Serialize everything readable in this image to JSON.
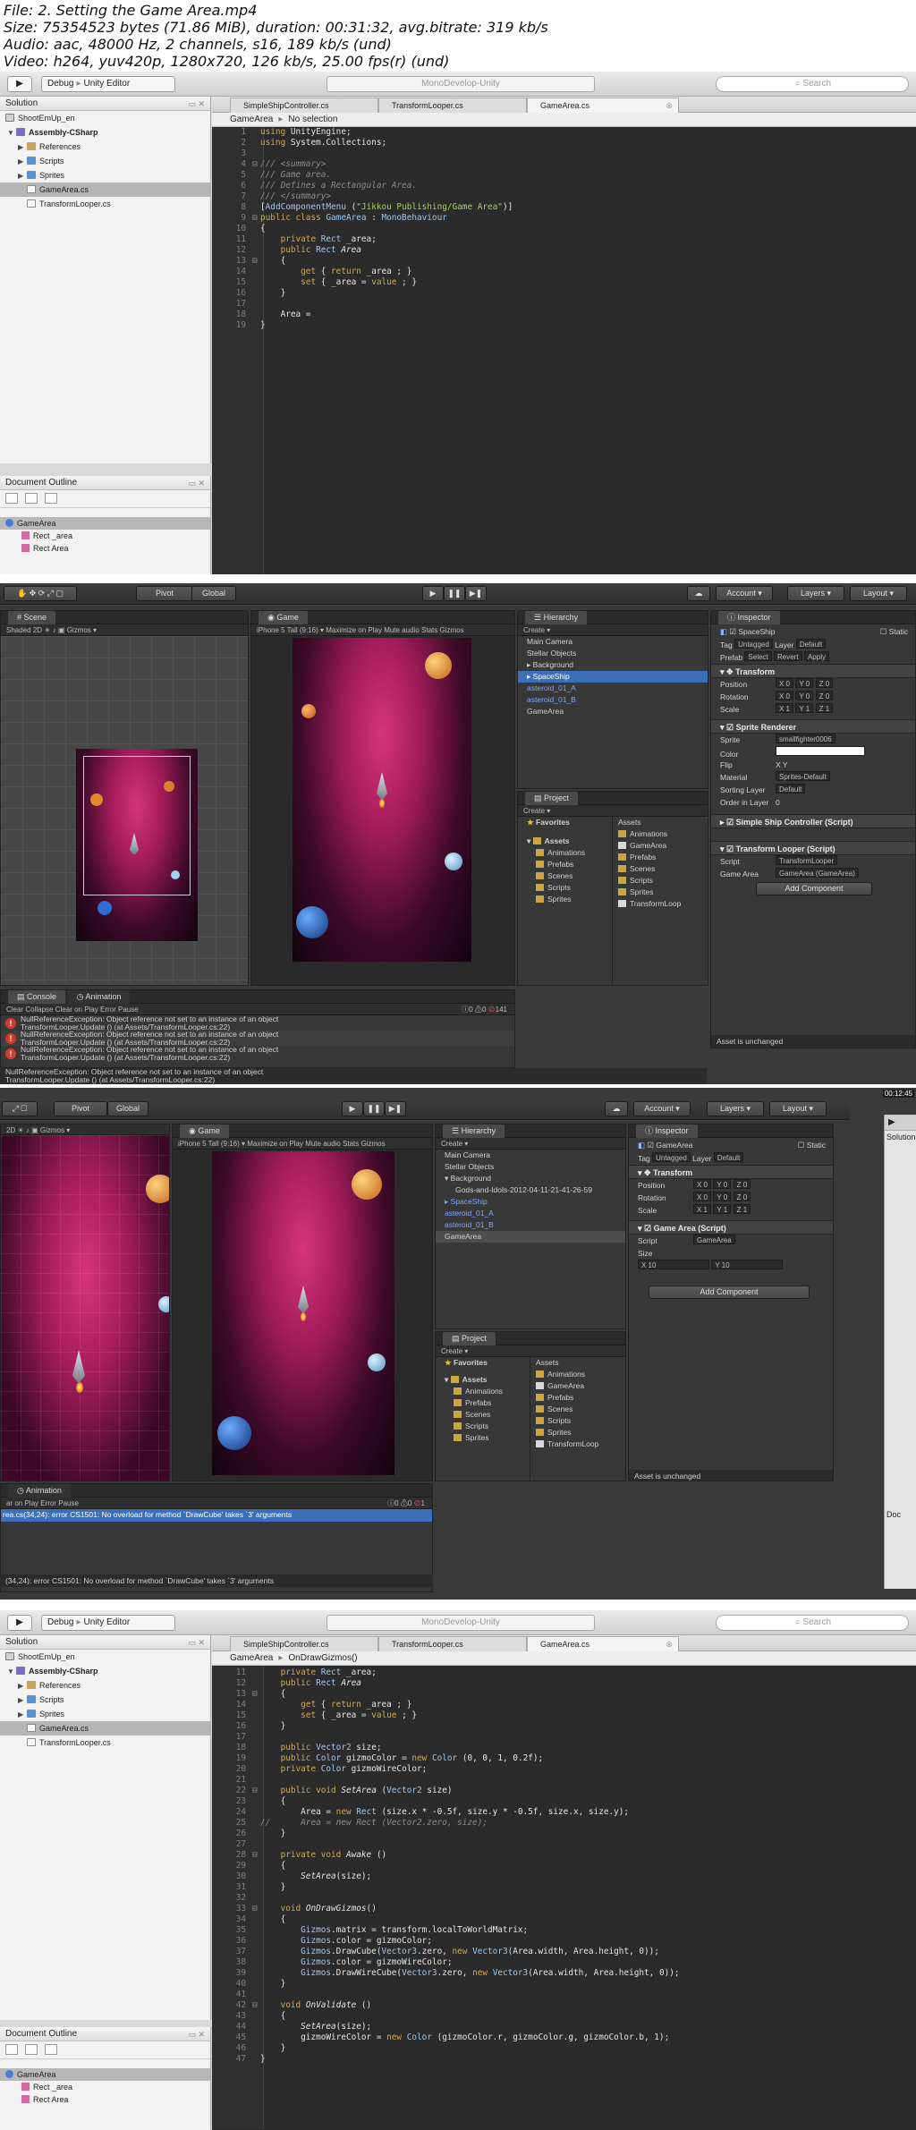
{
  "header": {
    "file": "File: 2. Setting the Game Area.mp4",
    "size": "Size: 75354523 bytes (71.86 MiB), duration: 00:31:32, avg.bitrate: 319 kb/s",
    "audio": "Audio: aac, 48000 Hz, 2 channels, s16, 189 kb/s (und)",
    "video": "Video: h264, yuv420p, 1280x720, 126 kb/s, 25.00 fps(r) (und)"
  },
  "md": {
    "config": "Debug",
    "target": "Unity Editor",
    "status": "MonoDevelop-Unity",
    "search_placeholder": "Search",
    "solution_title": "Solution",
    "tree": [
      "ShootEmUp_en",
      "Assembly-CSharp",
      "References",
      "Scripts",
      "Sprites",
      "GameArea.cs",
      "TransformLooper.cs"
    ],
    "tabs": [
      "SimpleShipController.cs",
      "TransformLooper.cs",
      "GameArea.cs"
    ],
    "outline_title": "Document Outline",
    "outline_class": "GameArea",
    "outline_members": [
      "Rect _area",
      "Rect Area"
    ],
    "breadcrumb1": [
      "GameArea",
      "No selection"
    ],
    "breadcrumb4": [
      "GameArea",
      "OnDrawGizmos()"
    ]
  },
  "code1": [
    {
      "n": "1",
      "html": "<span class=\"kw\">using</span> UnityEngine;"
    },
    {
      "n": "2",
      "html": "<span class=\"kw\">using</span> System.Collections;"
    },
    {
      "n": "3",
      "html": ""
    },
    {
      "n": "4",
      "html": "<span class=\"cm\">/// &lt;summary&gt;</span>",
      "fold": "⊟"
    },
    {
      "n": "5",
      "html": "<span class=\"cm\">/// Game area.</span>"
    },
    {
      "n": "6",
      "html": "<span class=\"cm\">/// Defines a Rectangular Area.</span>"
    },
    {
      "n": "7",
      "html": "<span class=\"cm\">/// &lt;/summary&gt;</span>"
    },
    {
      "n": "8",
      "html": "[<span class=\"ty\">AddComponentMenu</span> (<span class=\"str\">\"Jikkou Publishing/Game Area\"</span>)]"
    },
    {
      "n": "9",
      "html": "<span class=\"kw\">public class</span> <span class=\"ty\">GameArea</span> : <span class=\"ty\">MonoBehaviour</span>",
      "fold": "⊟"
    },
    {
      "n": "10",
      "html": "{"
    },
    {
      "n": "11",
      "html": "    <span class=\"kw\">private</span> <span class=\"ty\">Rect</span> _area;"
    },
    {
      "n": "12",
      "html": "    <span class=\"kw\">public</span> <span class=\"ty\">Rect</span> <span class=\"it\">Area</span>"
    },
    {
      "n": "13",
      "html": "    {",
      "fold": "⊟"
    },
    {
      "n": "14",
      "html": "        <span class=\"kw\">get</span> { <span class=\"kw\">return</span> _area ; }"
    },
    {
      "n": "15",
      "html": "        <span class=\"kw\">set</span> { _area = <span class=\"kw\">value</span> ; }"
    },
    {
      "n": "16",
      "html": "    }"
    },
    {
      "n": "17",
      "html": ""
    },
    {
      "n": "18",
      "html": "    Area ="
    },
    {
      "n": "19",
      "html": "}"
    }
  ],
  "code4": [
    {
      "n": "11",
      "html": "    <span class=\"kw\">private</span> <span class=\"ty\">Rect</span> _area;"
    },
    {
      "n": "12",
      "html": "    <span class=\"kw\">public</span> <span class=\"ty\">Rect</span> <span class=\"it\">Area</span>"
    },
    {
      "n": "13",
      "html": "    {",
      "fold": "⊟"
    },
    {
      "n": "14",
      "html": "        <span class=\"kw\">get</span> { <span class=\"kw\">return</span> _area ; }"
    },
    {
      "n": "15",
      "html": "        <span class=\"kw\">set</span> { _area = <span class=\"kw\">value</span> ; }"
    },
    {
      "n": "16",
      "html": "    }"
    },
    {
      "n": "17",
      "html": ""
    },
    {
      "n": "18",
      "html": "    <span class=\"kw\">public</span> <span class=\"ty\">Vector2</span> size;"
    },
    {
      "n": "19",
      "html": "    <span class=\"kw\">public</span> <span class=\"ty\">Color</span> gizmoColor = <span class=\"kw\">new</span> <span class=\"ty\">Color</span> (0, 0, 1, 0.2f);"
    },
    {
      "n": "20",
      "html": "    <span class=\"kw\">private</span> <span class=\"ty\">Color</span> gizmoWireColor;"
    },
    {
      "n": "21",
      "html": ""
    },
    {
      "n": "22",
      "html": "    <span class=\"kw\">public void</span> <span class=\"it\">SetArea</span> (<span class=\"ty\">Vector2</span> size)",
      "fold": "⊟"
    },
    {
      "n": "23",
      "html": "    {"
    },
    {
      "n": "24",
      "html": "        Area = <span class=\"kw\">new</span> <span class=\"ty\">Rect</span> (size.x * -0.5f, size.y * -0.5f, size.x, size.y);"
    },
    {
      "n": "25",
      "html": "<span class=\"cm\">//      Area = new Rect (Vector2.zero, size);</span>"
    },
    {
      "n": "26",
      "html": "    }"
    },
    {
      "n": "27",
      "html": ""
    },
    {
      "n": "28",
      "html": "    <span class=\"kw\">private void</span> <span class=\"it\">Awake</span> ()",
      "fold": "⊟"
    },
    {
      "n": "29",
      "html": "    {"
    },
    {
      "n": "30",
      "html": "        <span class=\"it\">SetArea</span>(size);"
    },
    {
      "n": "31",
      "html": "    }"
    },
    {
      "n": "32",
      "html": ""
    },
    {
      "n": "33",
      "html": "    <span class=\"kw\">void</span> <span class=\"it\">OnDrawGizmos</span>()",
      "fold": "⊟"
    },
    {
      "n": "34",
      "html": "    {"
    },
    {
      "n": "35",
      "html": "        <span class=\"ty\">Gizmos</span>.matrix = transform.localToWorldMatrix;"
    },
    {
      "n": "36",
      "html": "        <span class=\"ty\">Gizmos</span>.color = gizmoColor;"
    },
    {
      "n": "37",
      "html": "        <span class=\"ty\">Gizmos</span>.DrawCube(<span class=\"ty\">Vector3</span>.zero, <span class=\"kw\">new</span> <span class=\"ty\">Vector3</span>(Area.width, Area.height, 0));"
    },
    {
      "n": "38",
      "html": "        <span class=\"ty\">Gizmos</span>.color = gizmoWireColor;"
    },
    {
      "n": "39",
      "html": "        <span class=\"ty\">Gizmos</span>.DrawWireCube(<span class=\"ty\">Vector3</span>.zero, <span class=\"kw\">new</span> <span class=\"ty\">Vector3</span>(Area.width, Area.height, 0));"
    },
    {
      "n": "40",
      "html": "    }"
    },
    {
      "n": "41",
      "html": ""
    },
    {
      "n": "42",
      "html": "    <span class=\"kw\">void</span> <span class=\"it\">OnValidate</span> ()",
      "fold": "⊟"
    },
    {
      "n": "43",
      "html": "    {"
    },
    {
      "n": "44",
      "html": "        <span class=\"it\">SetArea</span>(size);"
    },
    {
      "n": "45",
      "html": "        gizmoWireColor = <span class=\"kw\">new</span> <span class=\"ty\">Color</span> (gizmoColor.r, gizmoColor.g, gizmoColor.b, 1);"
    },
    {
      "n": "46",
      "html": "    }"
    },
    {
      "n": "47",
      "html": "}"
    }
  ],
  "unity2": {
    "toolbar": {
      "pivot": "Pivot",
      "global": "Global",
      "account": "Account",
      "layers": "Layers",
      "layout": "Layout"
    },
    "scene_tab": "Scene",
    "scene_shading": "Shaded",
    "scene_2d": "2D",
    "gizmos": "Gizmos",
    "game_tab": "Game",
    "game_aspect": "iPhone 5 Tall (9:16)",
    "game_opts": [
      "Maximize on Play",
      "Mute audio",
      "Stats",
      "Gizmos"
    ],
    "hierarchy_tab": "Hierarchy",
    "create": "Create",
    "hierarchy": [
      "Main Camera",
      "Stellar Objects",
      "Background",
      "SpaceShip",
      "asteroid_01_A",
      "asteroid_01_B",
      "GameArea"
    ],
    "project_tab": "Project",
    "favorites": "Favorites",
    "assets_label": "Assets",
    "assets_tree": [
      "Animations",
      "Prefabs",
      "Scenes",
      "Scripts",
      "Sprites"
    ],
    "assets_grid": [
      "Animations",
      "GameArea",
      "Prefabs",
      "Scenes",
      "Scripts",
      "Sprites",
      "TransformLoop"
    ],
    "inspector_tab": "Inspector",
    "obj_name": "SpaceShip",
    "static_label": "Static",
    "tag_label": "Tag",
    "tag_value": "Untagged",
    "layer_label": "Layer",
    "layer_value": "Default",
    "prefab_label": "Prefab",
    "prefab_btns": [
      "Select",
      "Revert",
      "Apply"
    ],
    "transform": "Transform",
    "pos_label": "Position",
    "rot_label": "Rotation",
    "scale_label": "Scale",
    "pos": [
      "X 0",
      "Y 0",
      "Z 0"
    ],
    "rot": [
      "X 0",
      "Y 0",
      "Z 0"
    ],
    "scale": [
      "X 1",
      "Y 1",
      "Z 1"
    ],
    "sprite_renderer": "Sprite Renderer",
    "sr_rows": [
      [
        "Sprite",
        "smallfighter0006"
      ],
      [
        "Color",
        ""
      ],
      [
        "Flip",
        "X   Y"
      ],
      [
        "Material",
        "Sprites-Default"
      ],
      [
        "Sorting Layer",
        "Default"
      ],
      [
        "Order in Layer",
        "0"
      ]
    ],
    "ssc": "Simple Ship Controller (Script)",
    "tl": "Transform Looper (Script)",
    "tl_script_label": "Script",
    "tl_script": "TransformLooper",
    "tl_area_label": "Game Area",
    "tl_area": "GameArea (GameArea)",
    "add_component": "Add Component",
    "console_tab": "Console",
    "animation_tab": "Animation",
    "console_btns": [
      "Clear",
      "Collapse",
      "Clear on Play",
      "Error Pause"
    ],
    "console_count": "141",
    "console_counts": [
      "0",
      "0"
    ],
    "errors": [
      [
        "NullReferenceException: Object reference not set to an instance of an object",
        "TransformLooper.Update () (at Assets/TransformLooper.cs:22)"
      ],
      [
        "NullReferenceException: Object reference not set to an instance of an object",
        "TransformLooper.Update () (at Assets/TransformLooper.cs:22)"
      ],
      [
        "NullReferenceException: Object reference not set to an instance of an object",
        "TransformLooper.Update () (at Assets/TransformLooper.cs:22)"
      ]
    ],
    "status": [
      "NullReferenceException: Object reference not set to an instance of an object",
      "TransformLooper.Update () (at Assets/TransformLooper.cs:22)"
    ],
    "asset_status": "Asset is unchanged"
  },
  "unity3": {
    "hierarchy": [
      "Main Camera",
      "Stellar Objects",
      "Background",
      "Gods-and-Idols-2012-04-11-21-41-26-59",
      "SpaceShip",
      "asteroid_01_A",
      "asteroid_01_B",
      "GameArea"
    ],
    "obj_name": "GameArea",
    "transform": "Transform",
    "pos_label": "Position",
    "rot_label": "Rotation",
    "scale_label": "Scale",
    "pos": [
      "X 0",
      "Y 0",
      "Z 0"
    ],
    "rot": [
      "X 0",
      "Y 0",
      "Z 0"
    ],
    "scale": [
      "X 1",
      "Y 1",
      "Z 1"
    ],
    "ga_script": "Game Area (Script)",
    "script_label": "Script",
    "script_value": "GameArea",
    "size_label": "Size",
    "size": [
      "X 10",
      "Y 10"
    ],
    "add_component": "Add Component",
    "error_line": "rea.cs(34,24): error CS1501: No overload for method `DrawCube' takes `3' arguments",
    "status": "(34,24): error CS1501: No overload for method `DrawCube' takes `3' arguments",
    "asset_status": "Asset is unchanged",
    "error_count": "1",
    "anim_tab": "Animation",
    "console_btns": [
      "ar on Play",
      "Error Pause"
    ],
    "solution_peek": "Solution",
    "doc_peek": "Doc"
  },
  "timestamps": [
    "00:12:45"
  ]
}
